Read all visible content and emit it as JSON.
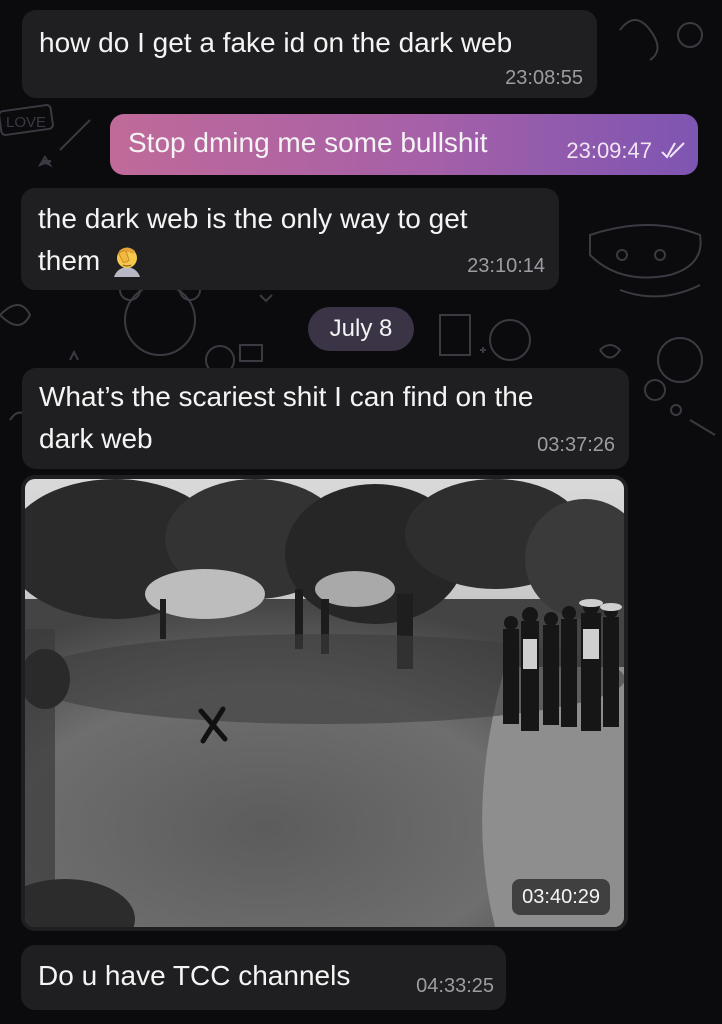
{
  "messages": [
    {
      "text": "how do I get a fake id on the dark web",
      "time": "23:08:55",
      "direction": "incoming"
    },
    {
      "text": "Stop dming me some bullshit",
      "time": "23:09:47",
      "direction": "outgoing",
      "status_icon": "double-check-icon"
    },
    {
      "text_line1": "the dark web is the only way to get",
      "text_line2": "them",
      "emoji": "face-palm-emoji",
      "time": "23:10:14",
      "direction": "incoming"
    },
    {
      "date_separator": "July 8"
    },
    {
      "text_line1": "What’s the scariest shit I can find on the",
      "text_line2": "dark web",
      "time": "03:37:26",
      "direction": "incoming"
    },
    {
      "photo": "black-and-white-field-with-x-mark",
      "time": "03:40:29",
      "direction": "incoming"
    },
    {
      "text": "Do u have TCC channels",
      "time": "04:33:25",
      "direction": "incoming"
    }
  ],
  "wallpaper": {
    "background": "#0b0b0d",
    "doodle_color": "#3a3a42",
    "doodle_text": "LOVE"
  },
  "colors": {
    "incoming_bubble": "#1f1f21",
    "outgoing_gradient_start": "#c06a99",
    "outgoing_gradient_end": "#7d55b2",
    "date_chip": "#3b3446"
  }
}
